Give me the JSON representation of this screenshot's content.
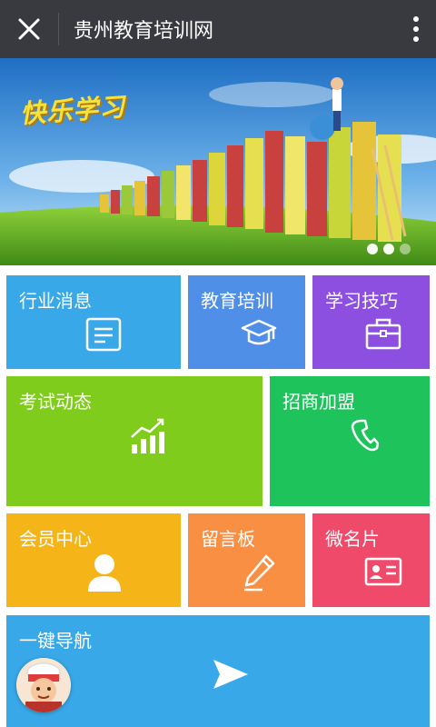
{
  "header": {
    "title": "贵州教育培训网"
  },
  "banner": {
    "headline": "快乐学习"
  },
  "tiles": [
    {
      "label": "行业消息",
      "icon": "document-icon"
    },
    {
      "label": "教育培训",
      "icon": "graduation-cap-icon"
    },
    {
      "label": "学习技巧",
      "icon": "briefcase-icon"
    },
    {
      "label": "考试动态",
      "icon": "bar-chart-trend-icon"
    },
    {
      "label": "招商加盟",
      "icon": "phone-icon"
    },
    {
      "label": "会员中心",
      "icon": "user-icon"
    },
    {
      "label": "留言板",
      "icon": "pen-icon"
    },
    {
      "label": "微名片",
      "icon": "id-card-icon"
    },
    {
      "label": "一键导航",
      "icon": "send-icon"
    }
  ],
  "colors": {
    "header_bg": "#393a3f",
    "tile_blue": "#38a8e8",
    "tile_indigo": "#4f8fe8",
    "tile_purple": "#8c4fe0",
    "tile_lime": "#7fcc1c",
    "tile_green": "#1ec45b",
    "tile_yellow": "#f5b418",
    "tile_orange": "#f98f42",
    "tile_pink": "#f04a6a"
  }
}
